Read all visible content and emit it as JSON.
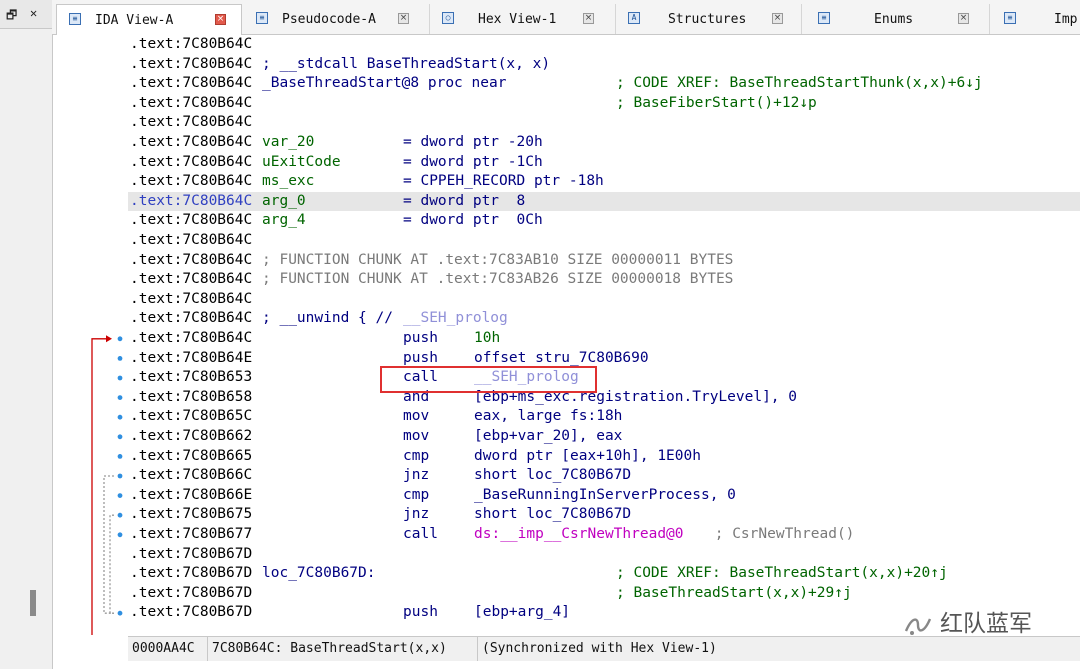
{
  "left_panel": {
    "restore_symbol": "🗗",
    "close_symbol": "✕"
  },
  "tabs": [
    {
      "label": "IDA View-A",
      "icon": "ida-view-icon",
      "active": true
    },
    {
      "label": "Pseudocode-A",
      "icon": "pseudocode-icon",
      "active": false
    },
    {
      "label": "Hex View-1",
      "icon": "hex-view-icon",
      "active": false
    },
    {
      "label": "Structures",
      "icon": "structures-icon",
      "active": false
    },
    {
      "label": "Enums",
      "icon": "enums-icon",
      "active": false
    },
    {
      "label": "Imp",
      "icon": "imports-icon",
      "active": false
    }
  ],
  "lines": [
    {
      "addr": ".text:7C80B64C",
      "c1": "",
      "c1_class": "c-navy",
      "c2": "",
      "c3": "",
      "c3_class": "c-navy",
      "xref": ""
    },
    {
      "addr": ".text:7C80B64C",
      "c1": "; __stdcall BaseThreadStart(x, x)",
      "c1_class": "c-navy",
      "c2": "",
      "c3": "",
      "c3_class": "c-navy",
      "xref": ""
    },
    {
      "addr": ".text:7C80B64C",
      "c1": "_BaseThreadStart@8 proc near",
      "c1_class": "c-navy",
      "c2": "",
      "c3": "",
      "c3_class": "c-navy",
      "xref": "; CODE XREF: BaseThreadStartThunk(x,x)+6↓j"
    },
    {
      "addr": ".text:7C80B64C",
      "c1": "",
      "c1_class": "c-navy",
      "c2": "",
      "c3": "",
      "c3_class": "c-navy",
      "xref": "; BaseFiberStart()+12↓p"
    },
    {
      "addr": ".text:7C80B64C",
      "c1": "",
      "c1_class": "c-navy",
      "c2": "",
      "c3": "",
      "c3_class": "c-navy",
      "xref": ""
    },
    {
      "addr": ".text:7C80B64C",
      "c1": "var_20",
      "c1_class": "c-green",
      "c2": "= dword ptr -20h",
      "c3": "",
      "c3_class": "c-navy",
      "xref": ""
    },
    {
      "addr": ".text:7C80B64C",
      "c1": "uExitCode",
      "c1_class": "c-green",
      "c2": "= dword ptr -1Ch",
      "c3": "",
      "c3_class": "c-navy",
      "xref": ""
    },
    {
      "addr": ".text:7C80B64C",
      "c1": "ms_exc",
      "c1_class": "c-green",
      "c2": "= CPPEH_RECORD ptr -18h",
      "c3": "",
      "c3_class": "c-navy",
      "xref": ""
    },
    {
      "addr": ".text:7C80B64C",
      "c1": "arg_0",
      "c1_class": "c-green",
      "c2": "= dword ptr  8",
      "c3": "",
      "c3_class": "c-navy",
      "xref": "",
      "highlight": true
    },
    {
      "addr": ".text:7C80B64C",
      "c1": "arg_4",
      "c1_class": "c-green",
      "c2": "= dword ptr  0Ch",
      "c3": "",
      "c3_class": "c-navy",
      "xref": ""
    },
    {
      "addr": ".text:7C80B64C",
      "c1": "",
      "c1_class": "c-navy",
      "c2": "",
      "c3": "",
      "c3_class": "c-navy",
      "xref": ""
    },
    {
      "addr": ".text:7C80B64C",
      "c1": "; FUNCTION CHUNK AT .text:7C83AB10 SIZE 00000011 BYTES",
      "c1_class": "c-comment",
      "c2": "",
      "c3": "",
      "c3_class": "c-navy",
      "xref": ""
    },
    {
      "addr": ".text:7C80B64C",
      "c1": "; FUNCTION CHUNK AT .text:7C83AB26 SIZE 00000018 BYTES",
      "c1_class": "c-comment",
      "c2": "",
      "c3": "",
      "c3_class": "c-navy",
      "xref": ""
    },
    {
      "addr": ".text:7C80B64C",
      "c1": "",
      "c1_class": "c-navy",
      "c2": "",
      "c3": "",
      "c3_class": "c-navy",
      "xref": ""
    },
    {
      "addr": ".text:7C80B64C",
      "c1": "; __unwind { // ",
      "c1_class": "c-navy",
      "c1b": "__SEH_prolog",
      "c2": "",
      "c3": "",
      "c3_class": "c-navy",
      "xref": ""
    },
    {
      "addr": ".text:7C80B64C",
      "c1": "",
      "c1_class": "c-navy",
      "c2": "push",
      "c3": "10h",
      "c3_class": "c-green",
      "xref": "",
      "dot": true
    },
    {
      "addr": ".text:7C80B64E",
      "c1": "",
      "c1_class": "c-navy",
      "c2": "push",
      "c3": "offset stru_7C80B690",
      "c3_class": "c-navy",
      "xref": "",
      "dot": true
    },
    {
      "addr": ".text:7C80B653",
      "c1": "",
      "c1_class": "c-navy",
      "c2": "call",
      "c3": "__SEH_prolog",
      "c3_class": "c-purple",
      "xref": "",
      "dot": true
    },
    {
      "addr": ".text:7C80B658",
      "c1": "",
      "c1_class": "c-navy",
      "c2": "and",
      "c3": "[ebp+ms_exc.registration.TryLevel], 0",
      "c3_class": "c-navy",
      "xref": "",
      "dot": true
    },
    {
      "addr": ".text:7C80B65C",
      "c1": "",
      "c1_class": "c-navy",
      "c2": "mov",
      "c3": "eax, large fs:18h",
      "c3_class": "c-navy",
      "xref": "",
      "dot": true
    },
    {
      "addr": ".text:7C80B662",
      "c1": "",
      "c1_class": "c-navy",
      "c2": "mov",
      "c3": "[ebp+var_20], eax",
      "c3_class": "c-navy",
      "xref": "",
      "dot": true
    },
    {
      "addr": ".text:7C80B665",
      "c1": "",
      "c1_class": "c-navy",
      "c2": "cmp",
      "c3": "dword ptr [eax+10h], 1E00h",
      "c3_class": "c-navy",
      "xref": "",
      "dot": true
    },
    {
      "addr": ".text:7C80B66C",
      "c1": "",
      "c1_class": "c-navy",
      "c2": "jnz",
      "c3": "short loc_7C80B67D",
      "c3_class": "c-navy",
      "xref": "",
      "dot": true
    },
    {
      "addr": ".text:7C80B66E",
      "c1": "",
      "c1_class": "c-navy",
      "c2": "cmp",
      "c3": "_BaseRunningInServerProcess, 0",
      "c3_class": "c-navy",
      "xref": "",
      "dot": true
    },
    {
      "addr": ".text:7C80B675",
      "c1": "",
      "c1_class": "c-navy",
      "c2": "jnz",
      "c3": "short loc_7C80B67D",
      "c3_class": "c-navy",
      "xref": "",
      "dot": true
    },
    {
      "addr": ".text:7C80B677",
      "c1": "",
      "c1_class": "c-navy",
      "c2": "call",
      "c3": "ds:__imp__CsrNewThread@0",
      "c3_class": "c-pink",
      "c3b": " ; CsrNewThread()",
      "xref": "",
      "dot": true
    },
    {
      "addr": ".text:7C80B67D",
      "c1": "",
      "c1_class": "c-navy",
      "c2": "",
      "c3": "",
      "c3_class": "c-navy",
      "xref": ""
    },
    {
      "addr": ".text:7C80B67D",
      "c1": "loc_7C80B67D:",
      "c1_class": "c-navy",
      "c2": "",
      "c3": "",
      "c3_class": "c-navy",
      "xref": "; CODE XREF: BaseThreadStart(x,x)+20↑j"
    },
    {
      "addr": ".text:7C80B67D",
      "c1": "",
      "c1_class": "c-navy",
      "c2": "",
      "c3": "",
      "c3_class": "c-navy",
      "xref": "; BaseThreadStart(x,x)+29↑j"
    },
    {
      "addr": ".text:7C80B67D",
      "c1": "",
      "c1_class": "c-navy",
      "c2": "push",
      "c3": "[ebp+arg_4]",
      "c3_class": "c-navy",
      "xref": "",
      "dot": true
    }
  ],
  "status": {
    "offset": "0000AA4C",
    "location": "7C80B64C: BaseThreadStart(x,x)",
    "sync": "(Synchronized with Hex View-1)"
  },
  "watermark": {
    "text": "红队蓝军",
    "icon": "wechat-channel-icon"
  },
  "colors": {
    "highlight_line": "#e6e6e6",
    "annotation_box": "#e03030",
    "arrow": "#cc0000",
    "dot": "#2f8fe0"
  }
}
